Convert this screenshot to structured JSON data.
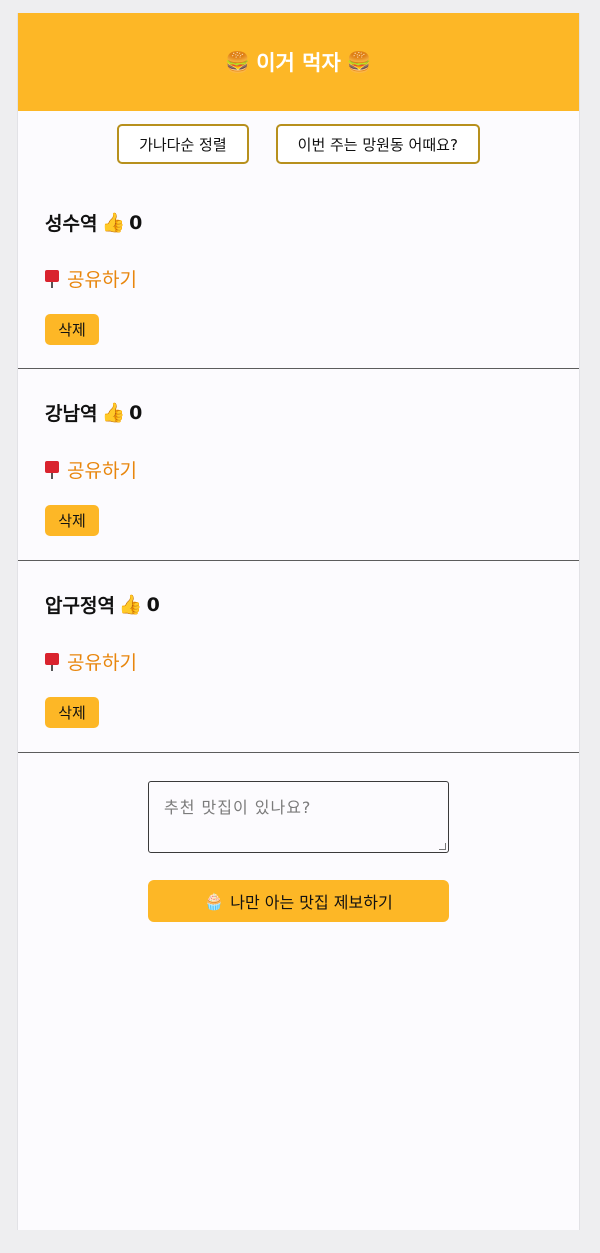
{
  "header": {
    "emoji": "🍔",
    "title": "이거 먹자"
  },
  "toolbar": {
    "sort_label": "가나다순 정렬",
    "suggest_label": "이번 주는 망원동 어때요?"
  },
  "items": [
    {
      "name": "성수역",
      "thumb": "👍",
      "likes": "0",
      "share_label": "공유하기",
      "delete_label": "삭제"
    },
    {
      "name": "강남역",
      "thumb": "👍",
      "likes": "0",
      "share_label": "공유하기",
      "delete_label": "삭제"
    },
    {
      "name": "압구정역",
      "thumb": "👍",
      "likes": "0",
      "share_label": "공유하기",
      "delete_label": "삭제"
    }
  ],
  "form": {
    "placeholder": "추천 맛집이 있나요?",
    "submit_emoji": "🧁",
    "submit_label": "나만 아는 맛집 제보하기"
  },
  "colors": {
    "accent": "#fdb726",
    "share_text": "#e8860d",
    "divider": "#5c5c5c"
  }
}
